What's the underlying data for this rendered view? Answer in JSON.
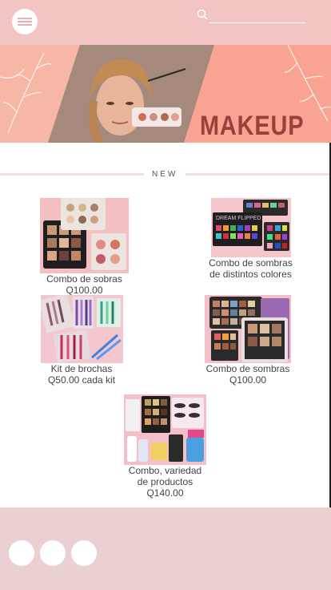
{
  "header": {
    "menu_icon": "hamburger-icon",
    "search_icon": "search-icon",
    "background_color": "#f2c4c4"
  },
  "banner": {
    "title": "MAKEUP",
    "title_color": "#9a3f3a"
  },
  "section": {
    "label": "NEW"
  },
  "products": [
    {
      "name": "Combo de sobras",
      "price": "Q100.00"
    },
    {
      "name": "Combo de sombras de distintos colores",
      "price": ""
    },
    {
      "name": "Kit de brochas",
      "price": "Q50.00 cada kit"
    },
    {
      "name": "Combo de sombras",
      "price": "Q100.00"
    },
    {
      "name": "Combo, variedad de productos",
      "price": "Q140.00"
    }
  ],
  "footer": {
    "background_color": "#ebd0d1",
    "social_icons": [
      "social-icon-1",
      "social-icon-2",
      "social-icon-3"
    ]
  }
}
